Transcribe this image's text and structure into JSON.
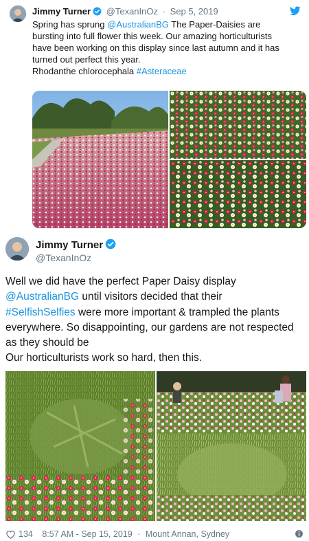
{
  "quoted": {
    "name": "Jimmy Turner",
    "handle": "@TexanInOz",
    "separator": "·",
    "date": "Sep 5, 2019",
    "text_parts": {
      "line1_a": "Spring has sprung ",
      "line1_link": "@AustralianBG",
      "line1_b": " The Paper-Daisies are",
      "line2": "bursting into full flower this week. Our amazing horticulturists",
      "line3": "have been working on this display since last autumn and it has",
      "line4": "turned out perfect this year.",
      "line5_a": "Rhodanthe chlorocephala ",
      "line5_link": "#Asteraceae"
    },
    "photos": [
      {
        "icon": "daisy-field-path-photo"
      },
      {
        "icon": "daisy-closeup-photo"
      },
      {
        "icon": "daisy-closeup-photo-2"
      }
    ]
  },
  "main": {
    "name": "Jimmy Turner",
    "handle": "@TexanInOz",
    "text_parts": {
      "line1": "Well we did have the perfect Paper Daisy display",
      "line2_link": "@AustralianBG",
      "line2_b": " until visitors decided that their",
      "line3_link": "#SelfishSelfies",
      "line3_b": " were more important & trampled the plants",
      "line4": "everywhere. So disappointing, our gardens are not respected",
      "line5": "as they should be",
      "line6": "Our horticulturists work so hard, then this."
    },
    "photos": [
      {
        "icon": "trampled-daisies-photo"
      },
      {
        "icon": "visitors-in-daisies-photo"
      }
    ]
  },
  "footer": {
    "likes": "134",
    "time": "8:57 AM - Sep 15, 2019",
    "separator": "·",
    "location": "Mount Annan, Sydney"
  },
  "colors": {
    "link": "#1b95e0",
    "verified": "#1da1f2",
    "secondary_text": "#657786",
    "twitter_bird": "#1da1f2"
  }
}
